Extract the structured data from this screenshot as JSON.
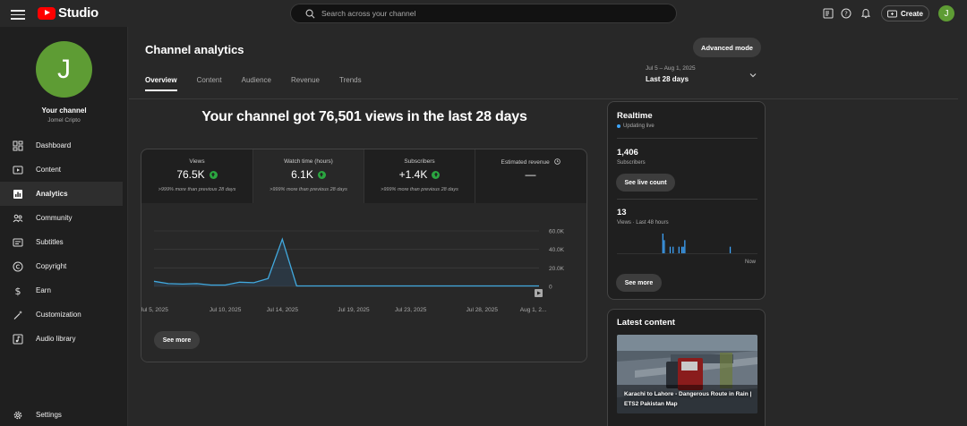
{
  "app": {
    "logo_text": "Studio"
  },
  "search": {
    "placeholder": "Search across your channel"
  },
  "header": {
    "create_label": "Create",
    "avatar_letter": "J"
  },
  "sidebar": {
    "avatar_letter": "J",
    "title": "Your channel",
    "subtitle": "Jomel Cripto",
    "items": [
      {
        "label": "Dashboard",
        "icon": "dashboard-icon"
      },
      {
        "label": "Content",
        "icon": "content-icon"
      },
      {
        "label": "Analytics",
        "icon": "analytics-icon"
      },
      {
        "label": "Community",
        "icon": "community-icon"
      },
      {
        "label": "Subtitles",
        "icon": "subtitles-icon"
      },
      {
        "label": "Copyright",
        "icon": "copyright-icon"
      },
      {
        "label": "Earn",
        "icon": "dollar-icon"
      },
      {
        "label": "Customization",
        "icon": "magic-wand-icon"
      },
      {
        "label": "Audio library",
        "icon": "audio-library-icon"
      }
    ],
    "active_item": "Analytics",
    "settings_label": "Settings"
  },
  "page": {
    "title": "Channel analytics",
    "advanced_mode_label": "Advanced mode",
    "tabs": [
      {
        "label": "Overview"
      },
      {
        "label": "Content"
      },
      {
        "label": "Audience"
      },
      {
        "label": "Revenue"
      },
      {
        "label": "Trends"
      }
    ],
    "active_tab": "Overview",
    "date_range": {
      "dates": "Jul 5 – Aug 1, 2025",
      "label": "Last 28 days"
    },
    "headline": "Your channel got 76,501 views in the last 28 days"
  },
  "metrics": [
    {
      "label": "Views",
      "value": "76.5K",
      "trend": "up",
      "sub": ">999% more than previous 28 days"
    },
    {
      "label": "Watch time (hours)",
      "value": "6.1K",
      "trend": "up",
      "sub": ">999% more than previous 28 days"
    },
    {
      "label": "Subscribers",
      "value": "+1.4K",
      "trend": "up",
      "sub": ">999% more than previous 28 days"
    },
    {
      "label": "Estimated revenue",
      "value": "—",
      "trend": "",
      "sub": ""
    }
  ],
  "overview_see_more": "See more",
  "chart_data": {
    "type": "area",
    "metric": "Views",
    "y_ticks": [
      "60.0K",
      "40.0K",
      "20.0K",
      "0"
    ],
    "ylim": [
      0,
      60000
    ],
    "x_ticks": [
      "Jul 5, 2025",
      "Jul 10, 2025",
      "Jul 14, 2025",
      "Jul 19, 2025",
      "Jul 23, 2025",
      "Jul 28, 2025",
      "Aug 1, 2..."
    ],
    "x": [
      "Jul 5",
      "Jul 6",
      "Jul 7",
      "Jul 8",
      "Jul 9",
      "Jul 10",
      "Jul 11",
      "Jul 12",
      "Jul 13",
      "Jul 14",
      "Jul 15",
      "Jul 16",
      "Jul 17",
      "Jul 18",
      "Jul 19",
      "Jul 20",
      "Jul 21",
      "Jul 22",
      "Jul 23",
      "Jul 24",
      "Jul 25",
      "Jul 26",
      "Jul 27",
      "Jul 28",
      "Jul 29",
      "Jul 30",
      "Jul 31",
      "Aug 1"
    ],
    "values": [
      5500,
      3000,
      2500,
      3000,
      1500,
      1500,
      4500,
      4000,
      8500,
      51000,
      500,
      500,
      500,
      500,
      500,
      500,
      500,
      500,
      500,
      500,
      500,
      500,
      500,
      500,
      500,
      500,
      500,
      500
    ],
    "grid": true,
    "y_axis_side": "right"
  },
  "realtime": {
    "title": "Realtime",
    "status": "Updating live",
    "subscribers_value": "1,406",
    "subscribers_label": "Subscribers",
    "live_count_button": "See live count",
    "views_value": "13",
    "views_label": "Views · Last 48 hours",
    "now_label": "Now",
    "hourly_views": [
      0,
      0,
      0,
      0,
      0,
      0,
      0,
      0,
      0,
      0,
      0,
      0,
      0,
      0,
      0,
      0,
      0,
      0,
      0,
      0,
      0,
      0,
      0,
      0,
      0,
      0,
      0,
      0,
      0,
      0,
      0,
      3,
      2,
      0,
      0,
      0,
      1,
      0,
      1,
      0,
      0,
      0,
      1,
      0,
      1,
      1,
      2,
      0,
      0,
      0,
      0,
      0,
      0,
      0,
      0,
      0,
      0,
      0,
      0,
      0,
      0,
      0,
      0,
      0,
      0,
      0,
      0,
      0,
      0,
      0,
      0,
      0,
      0,
      0,
      0,
      0,
      0,
      1,
      0,
      0,
      0,
      0,
      0,
      0,
      0,
      0,
      0,
      0,
      0,
      0,
      0,
      0,
      0,
      0,
      0,
      0
    ],
    "see_more_label": "See more"
  },
  "latest_content": {
    "title": "Latest content",
    "video_title": "Karachi to Lahore - Dangerous Route in Rain | ETS2 Pakistan Map"
  }
}
